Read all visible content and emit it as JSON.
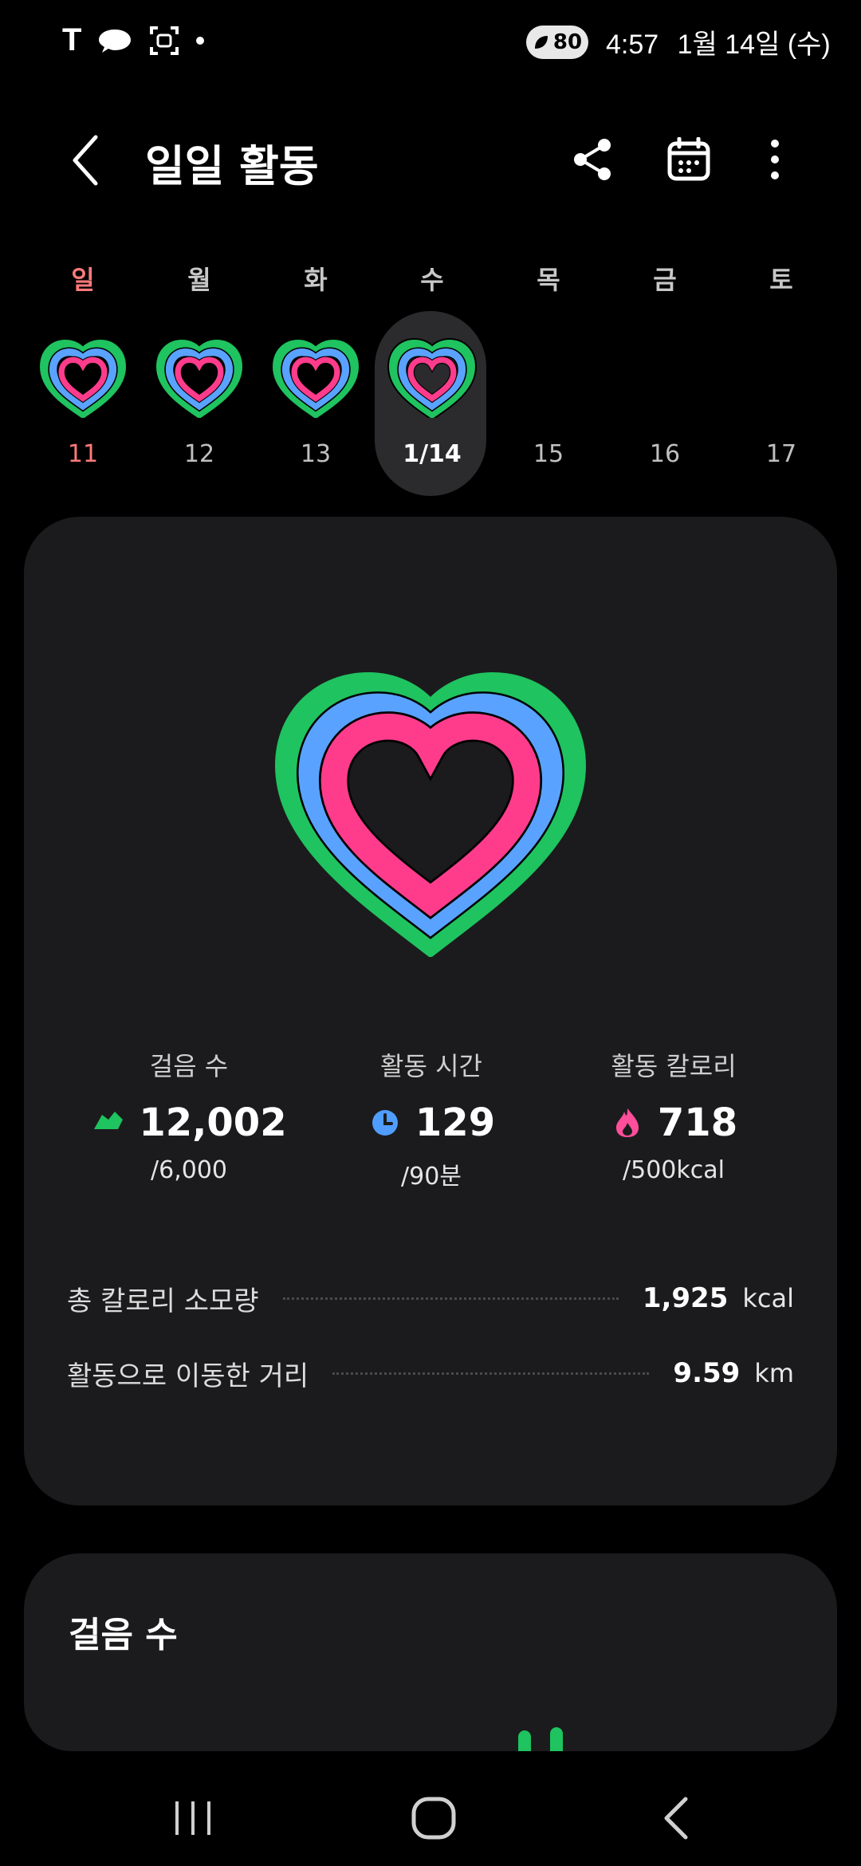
{
  "status_bar": {
    "carrier": "T",
    "battery": "80",
    "time": "4:57",
    "date": "1월 14일 (수)"
  },
  "header": {
    "title": "일일 활동",
    "icons": [
      "back-icon",
      "share-icon",
      "calendar-icon",
      "more-icon"
    ]
  },
  "week": {
    "days": [
      {
        "weekday": "일",
        "date": "11",
        "has_activity": true
      },
      {
        "weekday": "월",
        "date": "12",
        "has_activity": true
      },
      {
        "weekday": "화",
        "date": "13",
        "has_activity": true
      },
      {
        "weekday": "수",
        "date": "1/14",
        "has_activity": true
      },
      {
        "weekday": "목",
        "date": "15",
        "has_activity": false
      },
      {
        "weekday": "금",
        "date": "16",
        "has_activity": false
      },
      {
        "weekday": "토",
        "date": "17",
        "has_activity": false
      }
    ],
    "selected_index": 3
  },
  "summary": {
    "ring_colors": {
      "steps": "#1fc35f",
      "time": "#5aa2ff",
      "calories": "#ff3c8c"
    },
    "stats": [
      {
        "label": "걸음 수",
        "value": "12,002",
        "goal": "/6,000",
        "icon": "shoe-icon",
        "color": "#1fc35f"
      },
      {
        "label": "활동 시간",
        "value": "129",
        "goal": "/90분",
        "icon": "clock-icon",
        "color": "#4f9dff"
      },
      {
        "label": "활동 칼로리",
        "value": "718",
        "goal": "/500kcal",
        "icon": "flame-icon",
        "color": "#ff4f9a"
      }
    ],
    "total_calories": {
      "label": "총 칼로리 소모량",
      "value": "1,925",
      "unit": "kcal"
    },
    "distance": {
      "label": "활동으로 이동한 거리",
      "value": "9.59",
      "unit": "km"
    }
  },
  "steps_card": {
    "title": "걸음 수"
  },
  "nav_bar": {
    "icons": [
      "recents-icon",
      "home-icon",
      "back-nav-icon"
    ]
  }
}
